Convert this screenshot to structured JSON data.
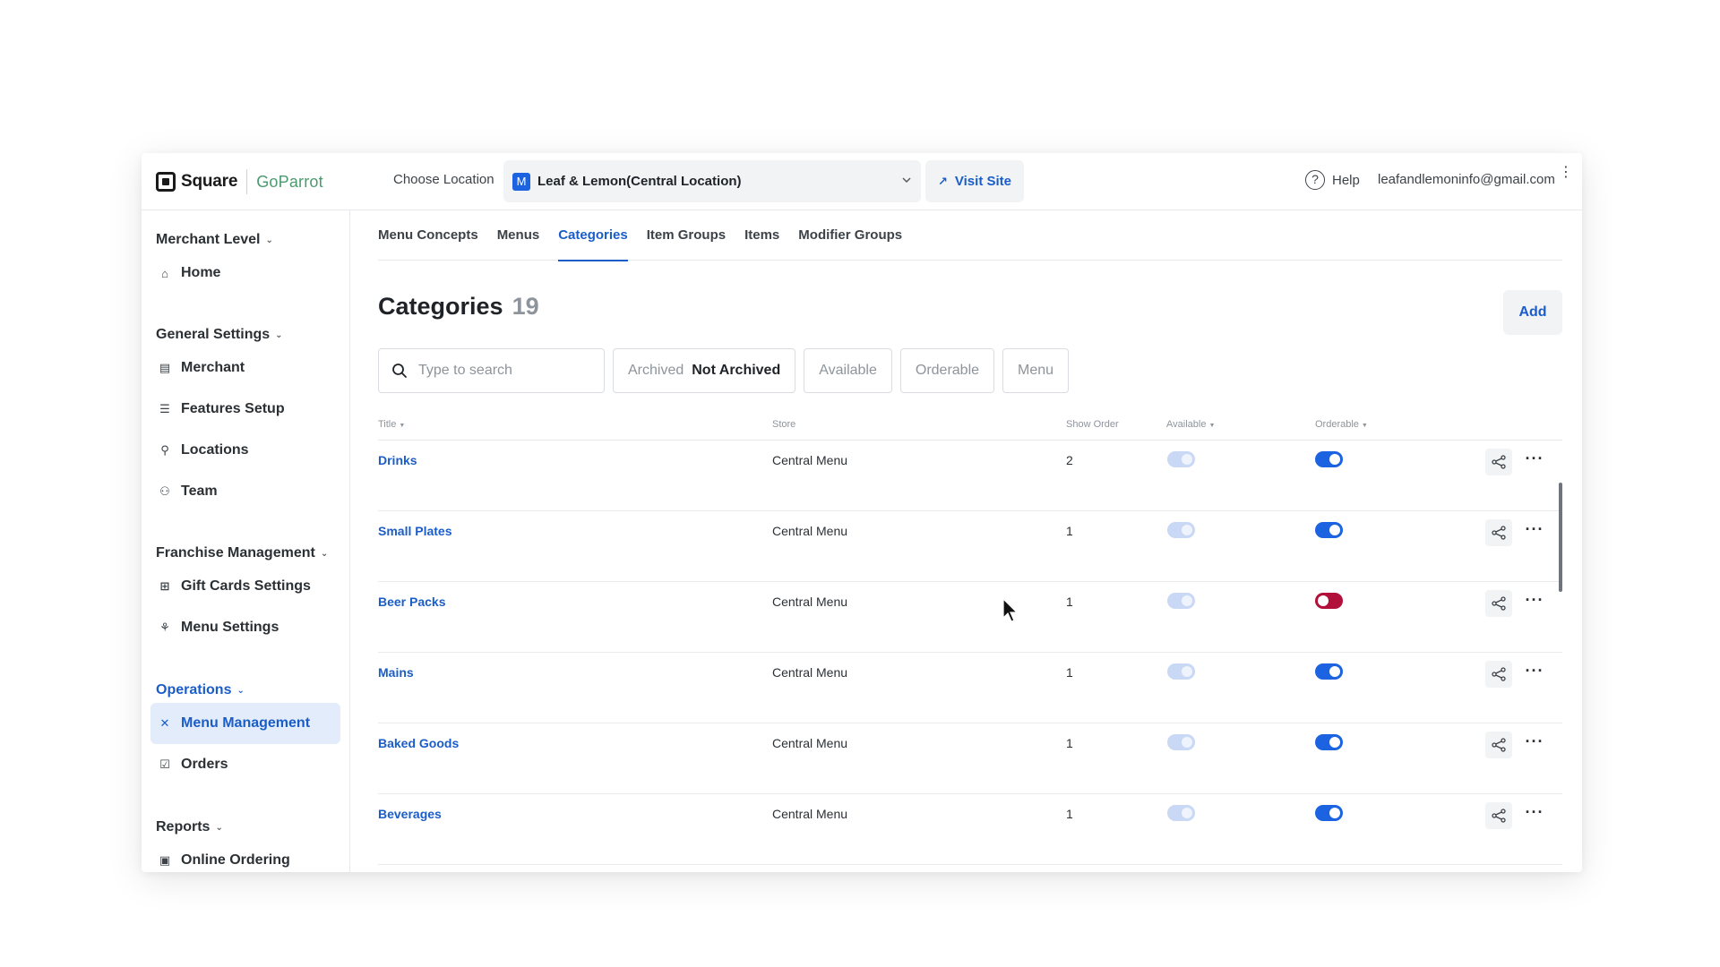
{
  "brand": {
    "square": "Square",
    "goparrot": "GoParrot"
  },
  "header": {
    "choose_location_label": "Choose Location",
    "location_avatar": "M",
    "location_name": "Leaf & Lemon(Central Location)",
    "visit_site_label": "Visit Site",
    "help_label": "Help",
    "user_email": "leafandlemoninfo@gmail.com"
  },
  "sidebar": {
    "merchant_level": "Merchant Level",
    "home": "Home",
    "general_settings": "General Settings",
    "merchant": "Merchant",
    "features_setup": "Features Setup",
    "locations": "Locations",
    "team": "Team",
    "franchise_management": "Franchise Management",
    "gift_cards_settings": "Gift Cards Settings",
    "menu_settings": "Menu Settings",
    "operations": "Operations",
    "menu_management": "Menu Management",
    "orders": "Orders",
    "reports": "Reports",
    "online_ordering": "Online Ordering"
  },
  "tabs": [
    {
      "label": "Menu Concepts",
      "active": false
    },
    {
      "label": "Menus",
      "active": false
    },
    {
      "label": "Categories",
      "active": true
    },
    {
      "label": "Item Groups",
      "active": false
    },
    {
      "label": "Items",
      "active": false
    },
    {
      "label": "Modifier Groups",
      "active": false
    }
  ],
  "page": {
    "title": "Categories",
    "count": "19",
    "add_label": "Add"
  },
  "filters": {
    "search_placeholder": "Type to search",
    "archived_label": "Archived",
    "archived_value": "Not Archived",
    "available_label": "Available",
    "orderable_label": "Orderable",
    "menu_label": "Menu"
  },
  "table": {
    "columns": {
      "title": "Title",
      "store": "Store",
      "show_order": "Show Order",
      "available": "Available",
      "orderable": "Orderable"
    },
    "rows": [
      {
        "title": "Drinks",
        "store": "Central Menu",
        "show_order": "2",
        "available": true,
        "orderable": "on"
      },
      {
        "title": "Small Plates",
        "store": "Central Menu",
        "show_order": "1",
        "available": true,
        "orderable": "on"
      },
      {
        "title": "Beer Packs",
        "store": "Central Menu",
        "show_order": "1",
        "available": true,
        "orderable": "off"
      },
      {
        "title": "Mains",
        "store": "Central Menu",
        "show_order": "1",
        "available": true,
        "orderable": "on"
      },
      {
        "title": "Baked Goods",
        "store": "Central Menu",
        "show_order": "1",
        "available": true,
        "orderable": "on"
      },
      {
        "title": "Beverages",
        "store": "Central Menu",
        "show_order": "1",
        "available": true,
        "orderable": "on"
      }
    ]
  },
  "icons": {
    "search": "search-icon",
    "share": "share-icon",
    "more": "more-horizontal-icon",
    "help": "help-circle-icon",
    "chevron": "chevron-down-icon"
  },
  "colors": {
    "accent": "#1b5dc8",
    "toggle_on": "#1b63e0",
    "toggle_off": "#b0103a",
    "toggle_disabled": "#c9d8f5",
    "brand_green": "#4b9b6e"
  }
}
